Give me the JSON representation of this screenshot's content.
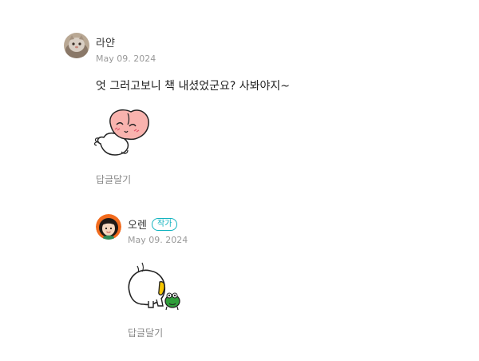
{
  "comments": [
    {
      "author": "라얀",
      "avatar": "cat-photo-avatar",
      "date": "May 09. 2024",
      "text": "엇 그러고보니 책 내셨었군요? 사봐야지~",
      "sticker": "apeach-lying-sticker",
      "reply_label": "답글달기"
    },
    {
      "author": "오렌",
      "avatar": "girl-illustration-avatar",
      "badge": "작가",
      "date": "May 09. 2024",
      "sticker": "character-bowing-with-frog-sticker",
      "reply_label": "답글달기"
    }
  ],
  "colors": {
    "badge": "#11b3bf",
    "date": "#999999",
    "reply": "#888888",
    "avatar_ring": "#f26b1d"
  }
}
